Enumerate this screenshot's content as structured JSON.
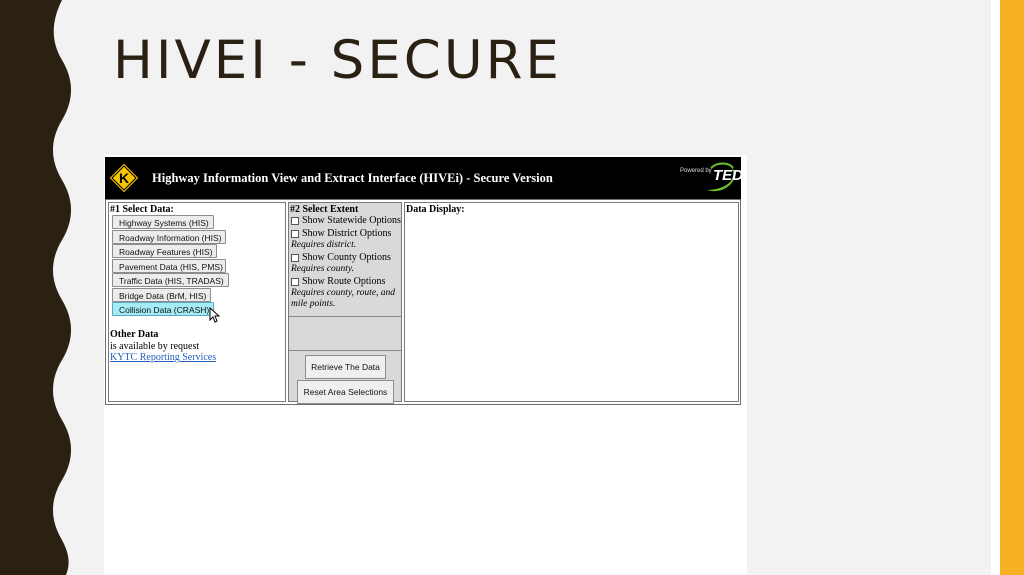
{
  "slide": {
    "title": "HIVEI - SECURE"
  },
  "colors": {
    "accent_stripe": "#f8b124",
    "left_band": "#2b2112",
    "banner_bg": "#000000",
    "highlight_button": "#a6ecf7",
    "link": "#1f5fbf"
  },
  "app": {
    "banner_title": "Highway Information View and Extract Interface (HIVEi) - Secure Version",
    "logo_letter": "K",
    "powered_by": "Powered by",
    "ted_text": "TED"
  },
  "select_data": {
    "heading": "#1 Select Data:",
    "buttons": [
      "Highway Systems (HIS)",
      "Roadway Information (HIS)",
      "Roadway Features (HIS)",
      "Pavement Data (HIS, PMS)",
      "Traffic Data (HIS, TRADAS)",
      "Bridge Data (BrM, HIS)",
      "Collision Data (CRASH)"
    ],
    "other_heading": "Other Data",
    "other_text": "is available by request",
    "other_link": "KYTC Reporting Services"
  },
  "select_extent": {
    "heading": "#2 Select Extent",
    "options": [
      {
        "label": "Show Statewide Options",
        "hint": ""
      },
      {
        "label": "Show District Options",
        "hint": "Requires district."
      },
      {
        "label": "Show County Options",
        "hint": "Requires county."
      },
      {
        "label": "Show Route Options",
        "hint": "Requires county, route, and mile points."
      }
    ],
    "retrieve_label": "Retrieve The Data",
    "reset_label": "Reset Area Selections"
  },
  "display": {
    "heading": "Data Display:"
  }
}
